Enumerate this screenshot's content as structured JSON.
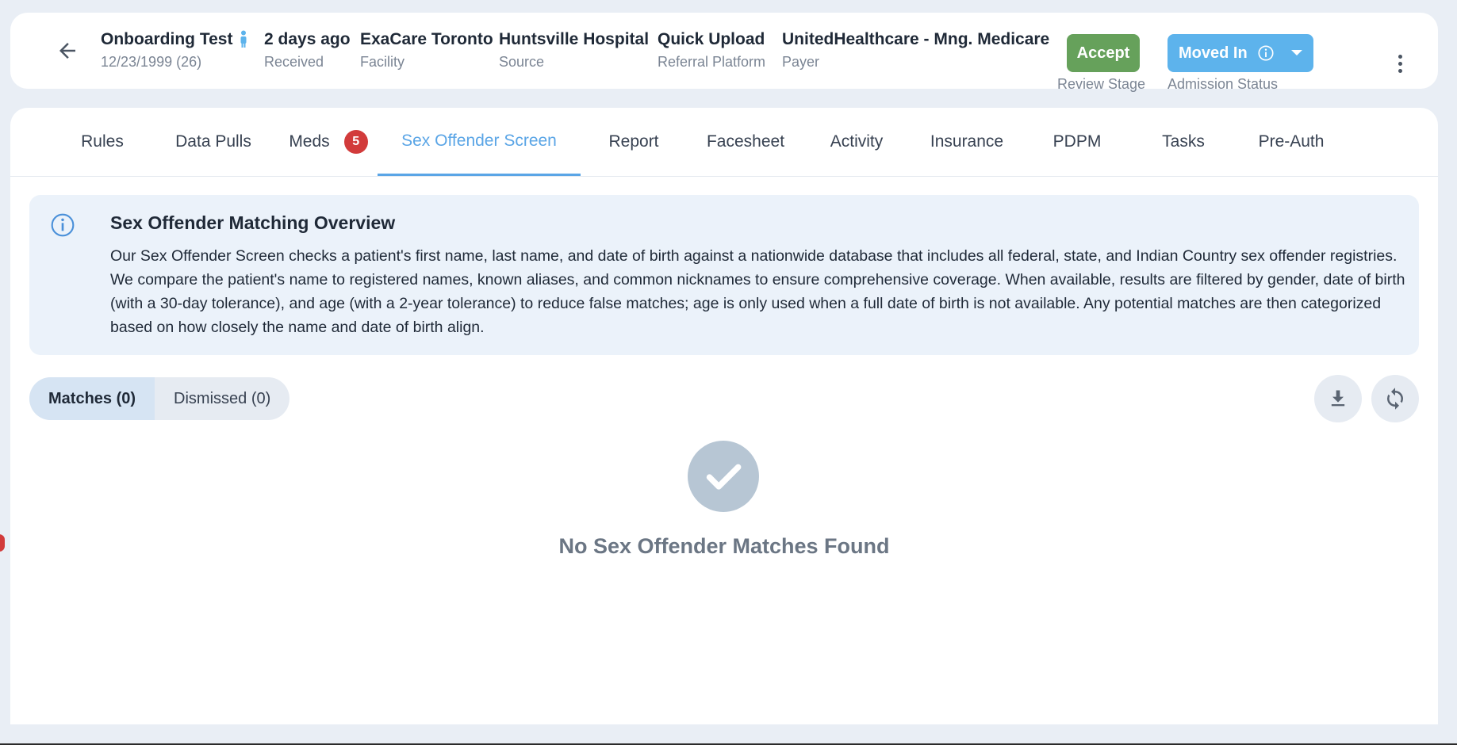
{
  "header": {
    "patient": {
      "name": "Onboarding Test",
      "dob": "12/23/1999 (26)"
    },
    "received": {
      "value": "2 days ago",
      "label": "Received"
    },
    "facility": {
      "value": "ExaCare Toronto",
      "label": "Facility"
    },
    "source": {
      "value": "Huntsville Hospital",
      "label": "Source"
    },
    "platform": {
      "value": "Quick Upload",
      "label": "Referral Platform"
    },
    "payer": {
      "value": "UnitedHealthcare - Mng. Medicare",
      "label": "Payer"
    },
    "review": {
      "button": "Accept",
      "label": "Review Stage"
    },
    "admission": {
      "button": "Moved In",
      "label": "Admission Status"
    }
  },
  "tabs": [
    {
      "label": "Rules"
    },
    {
      "label": "Data Pulls"
    },
    {
      "label": "Meds",
      "badge": "5"
    },
    {
      "label": "Sex Offender Screen",
      "active": true
    },
    {
      "label": "Report"
    },
    {
      "label": "Facesheet"
    },
    {
      "label": "Activity"
    },
    {
      "label": "Insurance"
    },
    {
      "label": "PDPM"
    },
    {
      "label": "Tasks"
    },
    {
      "label": "Pre-Auth"
    }
  ],
  "overview": {
    "title": "Sex Offender Matching Overview",
    "text": "Our Sex Offender Screen checks a patient's first name, last name, and date of birth against a nationwide database that includes all federal, state, and Indian Country sex offender registries. We compare the patient's name to registered names, known aliases, and common nicknames to ensure comprehensive coverage. When available, results are filtered by gender, date of birth (with a 30-day tolerance), and age (with a 2-year tolerance) to reduce false matches; age is only used when a full date of birth is not available. Any potential matches are then categorized based on how closely the name and date of birth align."
  },
  "filters": {
    "matches": "Matches (0)",
    "dismissed": "Dismissed (0)"
  },
  "empty_state": {
    "message": "No Sex Offender Matches Found"
  },
  "colors": {
    "accent": "#5aa5e6",
    "accept": "#66a15b",
    "status": "#5db3ec",
    "badge": "#d23b3b"
  }
}
